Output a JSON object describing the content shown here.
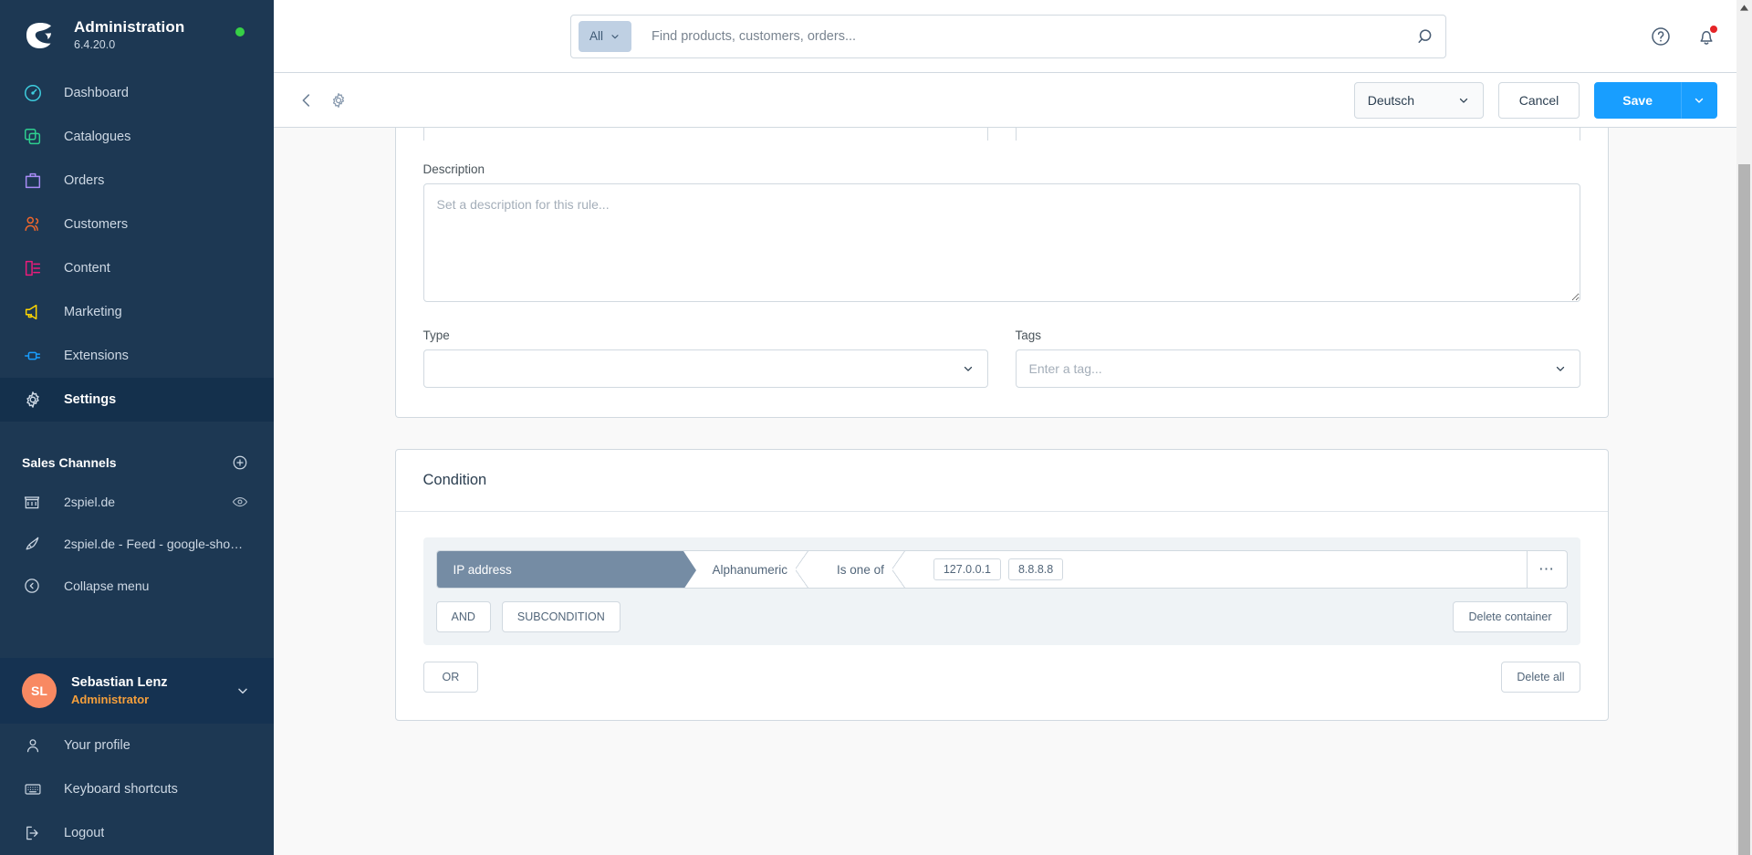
{
  "sidebar": {
    "app_title": "Administration",
    "version": "6.4.20.0",
    "status_color": "#37d046",
    "nav": [
      {
        "label": "Dashboard",
        "icon": "dashboard-icon",
        "active": false
      },
      {
        "label": "Catalogues",
        "icon": "catalogues-icon",
        "active": false
      },
      {
        "label": "Orders",
        "icon": "orders-icon",
        "active": false
      },
      {
        "label": "Customers",
        "icon": "customers-icon",
        "active": false
      },
      {
        "label": "Content",
        "icon": "content-icon",
        "active": false
      },
      {
        "label": "Marketing",
        "icon": "marketing-icon",
        "active": false
      },
      {
        "label": "Extensions",
        "icon": "extensions-icon",
        "active": false
      },
      {
        "label": "Settings",
        "icon": "settings-gear-icon",
        "active": true
      }
    ],
    "sales_channels_title": "Sales Channels",
    "channels": [
      {
        "label": "2spiel.de",
        "icon": "storefront-icon",
        "has_eye": true
      },
      {
        "label": "2spiel.de - Feed - google-shoppi…",
        "icon": "rocket-icon",
        "has_eye": false
      }
    ],
    "collapse_label": "Collapse menu",
    "user": {
      "initials": "SL",
      "name": "Sebastian Lenz",
      "role": "Administrator",
      "avatar_color": "#f88962",
      "role_color": "#f59f3b"
    },
    "user_menu": [
      {
        "label": "Your profile",
        "icon": "person-icon"
      },
      {
        "label": "Keyboard shortcuts",
        "icon": "keyboard-icon"
      },
      {
        "label": "Logout",
        "icon": "logout-icon"
      }
    ]
  },
  "topbar": {
    "search_type": "All",
    "search_value": "",
    "search_placeholder": "Find products, customers, orders...",
    "help_icon": "help-circle-icon",
    "notification_icon": "bell-icon",
    "notification_dot_color": "#e52427"
  },
  "smartbar": {
    "back_icon": "chevron-left-icon",
    "gear_icon": "gear-icon",
    "language": "Deutsch",
    "cancel_label": "Cancel",
    "save_label": "Save",
    "save_color": "#189eff"
  },
  "form": {
    "description_label": "Description",
    "description_value": "",
    "description_placeholder": "Set a description for this rule...",
    "type_label": "Type",
    "type_value": "",
    "tags_label": "Tags",
    "tags_value": "",
    "tags_placeholder": "Enter a tag..."
  },
  "condition": {
    "title": "Condition",
    "rule": {
      "field": "IP address",
      "format": "Alphanumeric",
      "operator": "Is one of",
      "values": [
        "127.0.0.1",
        "8.8.8.8"
      ],
      "more_label": "…",
      "field_color": "#758ca4"
    },
    "and_label": "AND",
    "subcondition_label": "SUBCONDITION",
    "delete_container_label": "Delete container",
    "or_label": "OR",
    "delete_all_label": "Delete all"
  }
}
